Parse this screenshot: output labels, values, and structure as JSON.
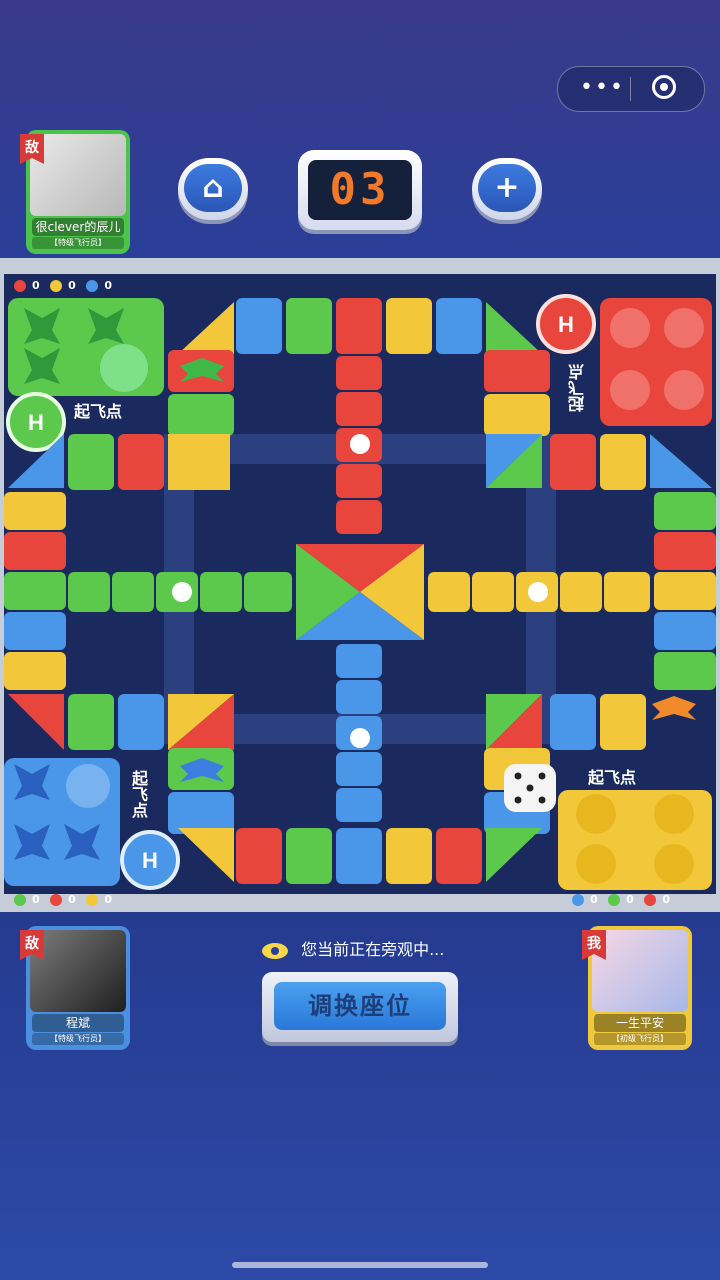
{
  "menu": {
    "more_icon": "more-dots-icon",
    "close_icon": "target-circle-icon"
  },
  "top_player": {
    "tag": "敌",
    "name": "很clever的辰儿",
    "rank": "【特级飞行员】",
    "color": "#4cc44c"
  },
  "left_bottom_player": {
    "tag": "敌",
    "name": "程斌",
    "rank": "【特级飞行员】",
    "color": "#4a8fe0"
  },
  "right_bottom_player": {
    "tag": "我",
    "name": "一生平安",
    "rank": "【初级飞行员】",
    "color": "#f0c83c"
  },
  "controls": {
    "home_icon": "home-icon",
    "counter": "03",
    "plus_icon": "plus-icon"
  },
  "stats": {
    "top_left": [
      "0",
      "0",
      "0"
    ],
    "bottom_left": [
      "0",
      "0",
      "0"
    ],
    "bottom_right": [
      "0",
      "0",
      "0"
    ]
  },
  "board": {
    "start_label": "起飞点",
    "hangar_label": "H",
    "colors": {
      "red": "#e8453c",
      "yellow": "#f2c83a",
      "blue": "#4a96e8",
      "green": "#5cc94c"
    }
  },
  "spectate_text": "您当前正在旁观中...",
  "swap_button": "调换座位"
}
